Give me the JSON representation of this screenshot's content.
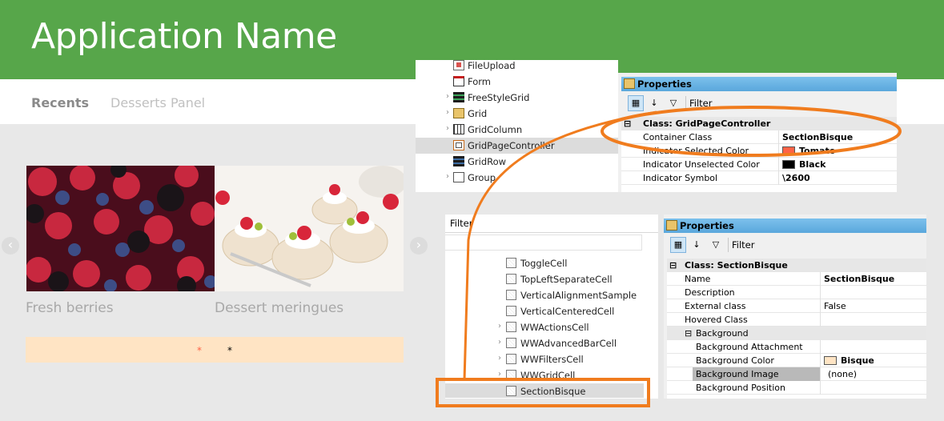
{
  "app": {
    "title": "Application Name",
    "tabs": [
      {
        "label": "Recents",
        "active": true
      },
      {
        "label": "Desserts Panel",
        "active": false
      }
    ],
    "carousel": {
      "items": [
        {
          "caption": "Fresh berries",
          "image": "berries"
        },
        {
          "caption": "Dessert meringues",
          "image": "meringue"
        }
      ],
      "prev_icon": "chevron-left-icon",
      "next_icon": "chevron-right-icon",
      "indicators": [
        {
          "symbol": "*",
          "color": "#FF6347",
          "selected": true
        },
        {
          "symbol": "*",
          "color": "#000000",
          "selected": false
        }
      ]
    },
    "colors": {
      "header": "#57A64A",
      "indicator_bar": "#FFE4C4",
      "callout": "#F07C1E"
    }
  },
  "tree_top": {
    "items": [
      {
        "label": "FileUpload",
        "icon": "file-upload-icon",
        "expandable": false,
        "selected": false
      },
      {
        "label": "Form",
        "icon": "form-icon",
        "expandable": false,
        "selected": false
      },
      {
        "label": "FreeStyleGrid",
        "icon": "freestyle-grid-icon",
        "expandable": true,
        "selected": false
      },
      {
        "label": "Grid",
        "icon": "grid-icon",
        "expandable": true,
        "selected": false
      },
      {
        "label": "GridColumn",
        "icon": "grid-column-icon",
        "expandable": true,
        "selected": false
      },
      {
        "label": "GridPageController",
        "icon": "grid-page-controller-icon",
        "expandable": false,
        "selected": true
      },
      {
        "label": "GridRow",
        "icon": "grid-row-icon",
        "expandable": false,
        "selected": false
      },
      {
        "label": "Group",
        "icon": "group-icon",
        "expandable": true,
        "selected": false
      }
    ]
  },
  "props_top": {
    "title": "Properties",
    "filter_label": "Filter",
    "class_header": "Class: GridPageController",
    "rows": [
      {
        "name": "Container Class",
        "value": "SectionBisque",
        "bold": true
      },
      {
        "name": "Indicator Selected Color",
        "value": "Tomato",
        "bold": true,
        "swatch": "#FF6347"
      },
      {
        "name": "Indicator Unselected Color",
        "value": "Black",
        "bold": true,
        "swatch": "#000000"
      },
      {
        "name": "Indicator Symbol",
        "value": "\\2600",
        "bold": true
      }
    ]
  },
  "tree_bottom": {
    "filter_label": "Filter",
    "items": [
      {
        "label": "ToggleCell",
        "expandable": false,
        "selected": false
      },
      {
        "label": "TopLeftSeparateCell",
        "expandable": false,
        "selected": false
      },
      {
        "label": "VerticalAlignmentSample",
        "expandable": false,
        "selected": false
      },
      {
        "label": "VerticalCenteredCell",
        "expandable": false,
        "selected": false
      },
      {
        "label": "WWActionsCell",
        "expandable": true,
        "selected": false
      },
      {
        "label": "WWAdvancedBarCell",
        "expandable": true,
        "selected": false
      },
      {
        "label": "WWFiltersCell",
        "expandable": true,
        "selected": false
      },
      {
        "label": "WWGridCell",
        "expandable": true,
        "selected": false
      },
      {
        "label": "SectionBisque",
        "expandable": false,
        "selected": true
      }
    ]
  },
  "props_bottom": {
    "title": "Properties",
    "filter_label": "Filter",
    "class_header": "Class: SectionBisque",
    "rows": [
      {
        "name": "Name",
        "value": "SectionBisque",
        "bold": true
      },
      {
        "name": "Description",
        "value": "",
        "bold": false
      },
      {
        "name": "External class",
        "value": "False",
        "bold": false
      },
      {
        "name": "Hovered Class",
        "value": "",
        "bold": false
      }
    ],
    "category": "Background",
    "category_rows": [
      {
        "name": "Background Attachment",
        "value": "",
        "bold": false
      },
      {
        "name": "Background Color",
        "value": "Bisque",
        "bold": true,
        "swatch": "#FFE4C4"
      },
      {
        "name": "Background Image",
        "value": "(none)",
        "bold": false,
        "highlight": true
      },
      {
        "name": "Background Position",
        "value": "",
        "bold": false
      }
    ]
  }
}
